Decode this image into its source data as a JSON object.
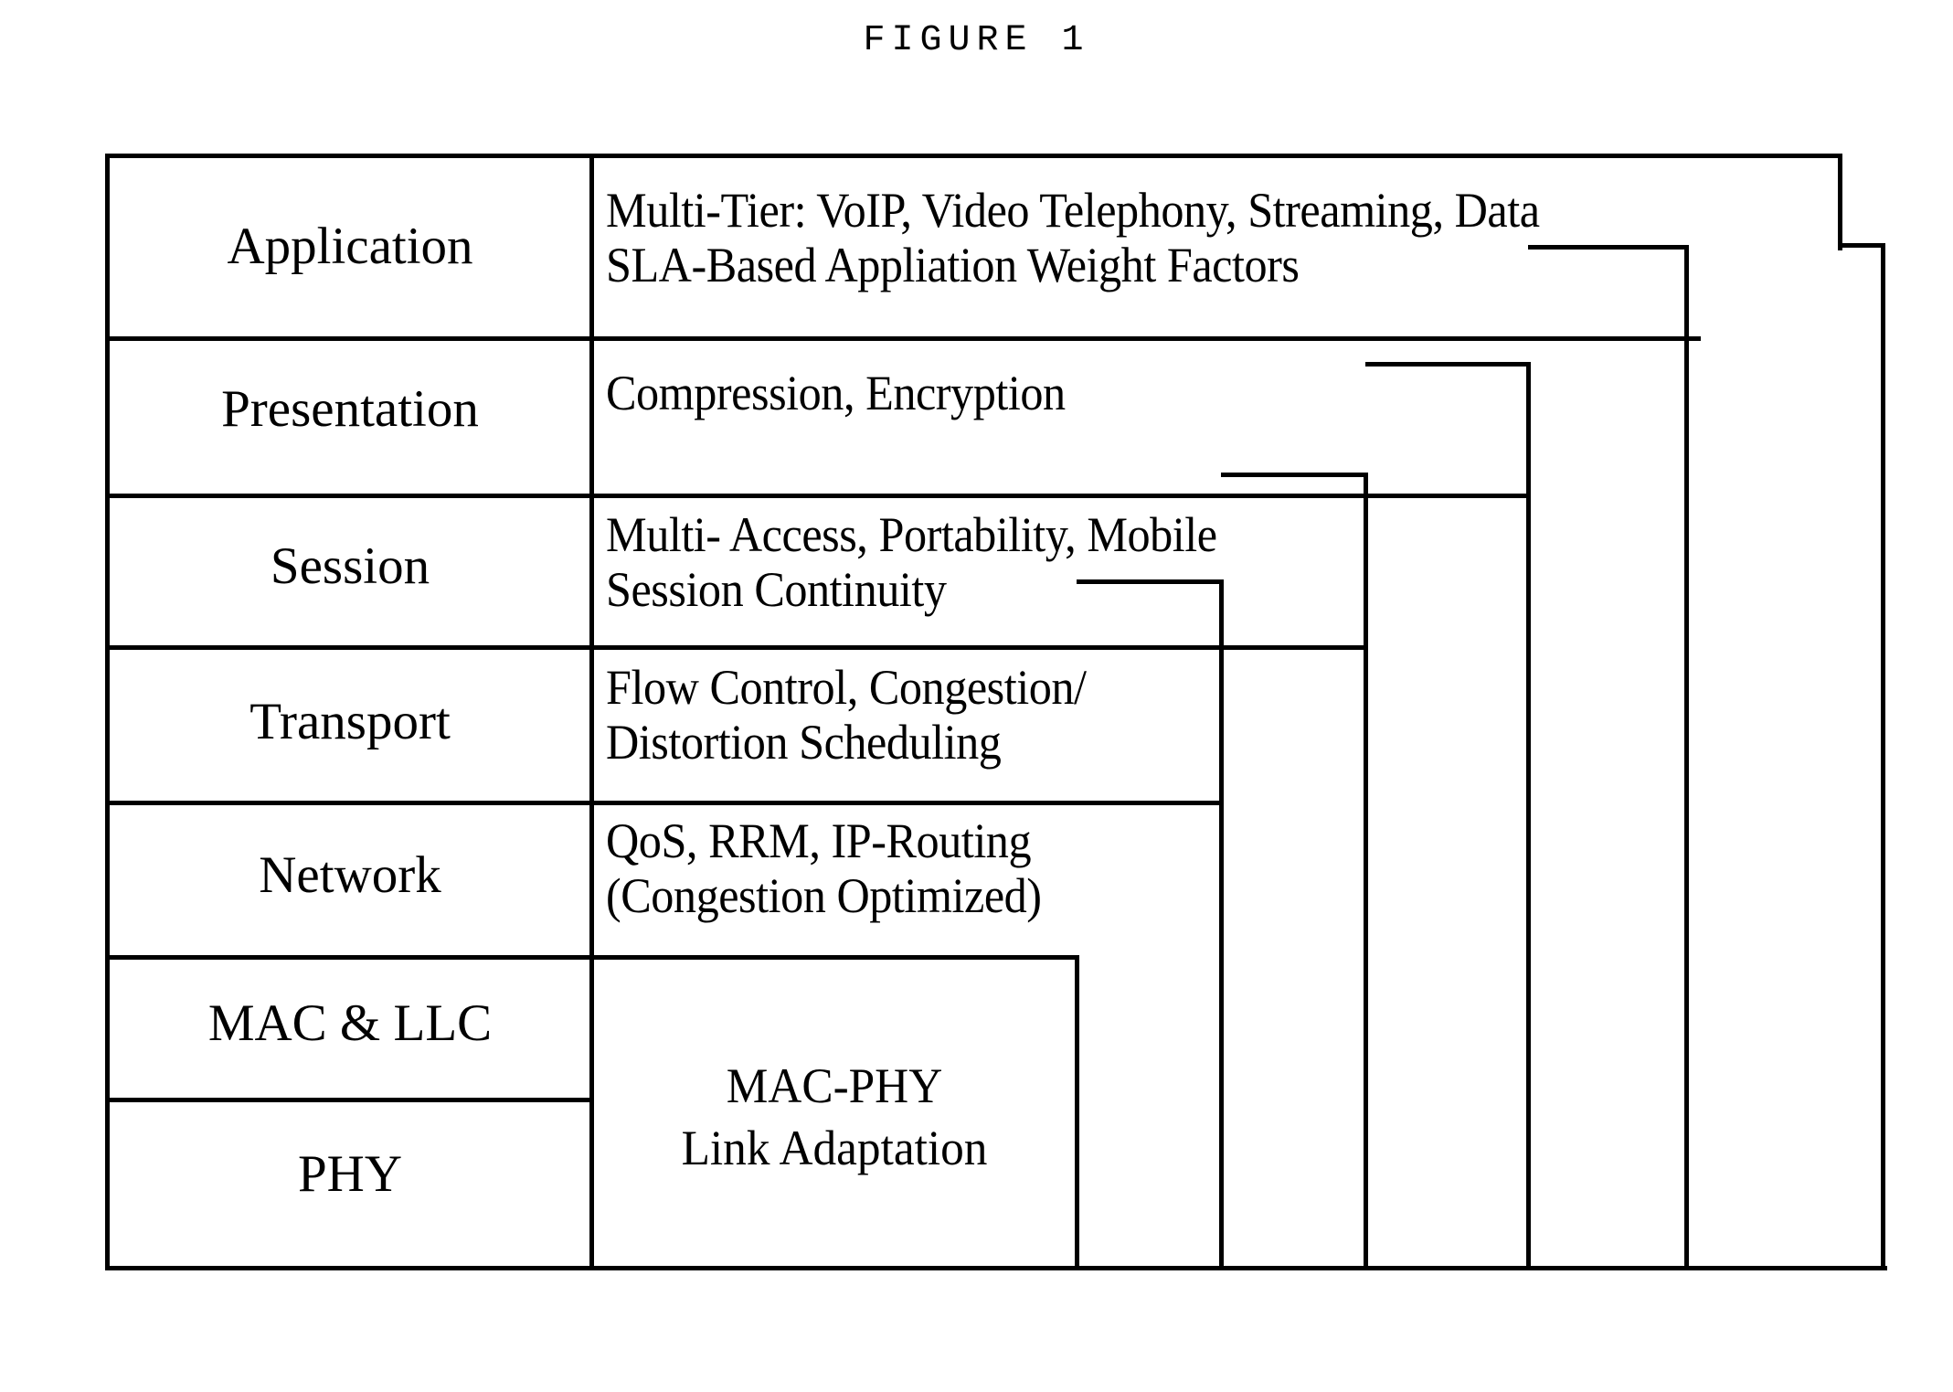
{
  "figure": {
    "title": "FIGURE 1",
    "caption_font": "monospace-typewriter"
  },
  "diagram": {
    "type": "osi-protocol-stack",
    "left_column_header": "",
    "right_column_header": "",
    "layers": [
      {
        "name": "Application",
        "description_line1": "Multi-Tier: VoIP, Video Telephony, Streaming, Data",
        "description_line2": "SLA-Based Appliation Weight Factors"
      },
      {
        "name": "Presentation",
        "description_line1": "Compression, Encryption",
        "description_line2": ""
      },
      {
        "name": "Session",
        "description_line1": "Multi- Access, Portability, Mobile",
        "description_line2": "Session Continuity"
      },
      {
        "name": "Transport",
        "description_line1": "Flow Control, Congestion/",
        "description_line2": "Distortion Scheduling"
      },
      {
        "name": "Network",
        "description_line1": "QoS, RRM, IP-Routing",
        "description_line2": "(Congestion Optimized)"
      },
      {
        "name": "MAC & LLC",
        "description_line1": "",
        "description_line2": ""
      },
      {
        "name": "PHY",
        "description_line1": "",
        "description_line2": ""
      }
    ],
    "spanning_box": {
      "label_line1": "MAC-PHY",
      "label_line2": "Link Adaptation",
      "spans_layers": [
        "MAC & LLC",
        "PHY"
      ]
    },
    "colors": {
      "stroke": "#000000",
      "background": "#ffffff",
      "text": "#000000"
    }
  }
}
